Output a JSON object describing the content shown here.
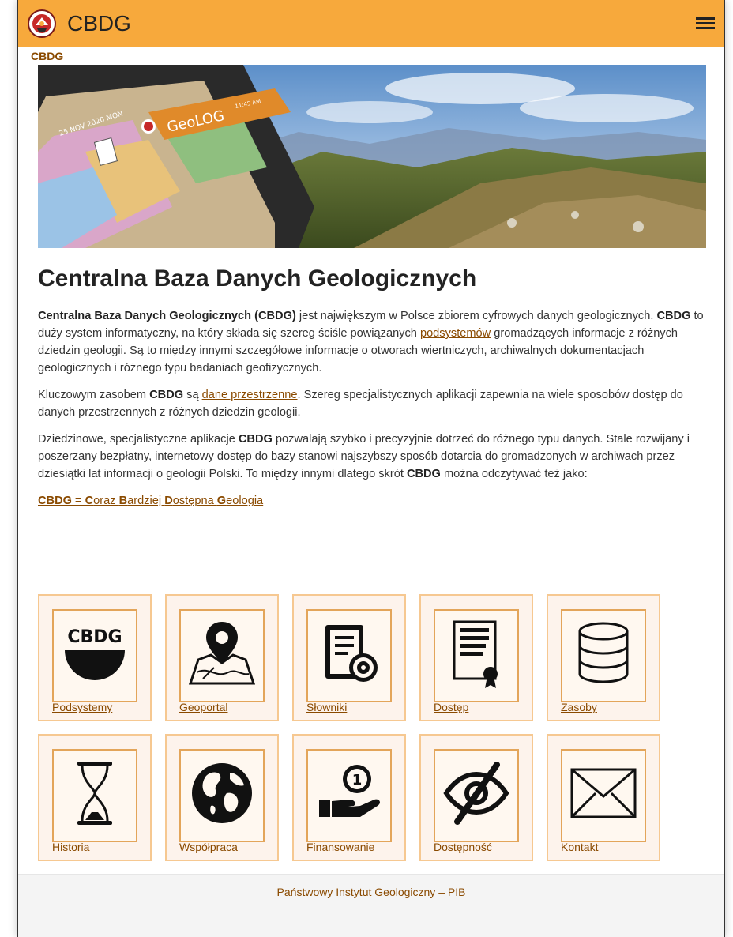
{
  "header": {
    "app_title": "CBDG",
    "logo_icon": "pgi-logo-icon",
    "menu_icon": "hamburger-menu-icon",
    "accent_color": "#f7a93c"
  },
  "breadcrumb": "CBDG",
  "hero": {
    "device_date": "25 NOV 2020 MON",
    "app_name": "GeoLOG",
    "time": "11:45 AM"
  },
  "main": {
    "title": "Centralna Baza Danych Geologicznych",
    "p1": {
      "bold1": "Centralna Baza Danych Geologicznych (CBDG)",
      "t1": " jest największym w Polsce zbiorem cyfrowych danych geologicznych. ",
      "bold2": "CBDG",
      "t2": " to duży system informatyczny, na który składa się szereg ściśle powiązanych ",
      "link": "podsystemów",
      "t3": " gromadzących informacje z różnych dziedzin geologii. Są to między innymi szczegółowe informacje o otworach wiertniczych, archiwalnych dokumentacjach geologicznych i różnego typu badaniach geofizycznych."
    },
    "p2": {
      "t1": "Kluczowym zasobem ",
      "bold1": "CBDG",
      "t2": " są ",
      "link": "dane przestrzenne",
      "t3": ". Szereg specjalistycznych aplikacji zapewnia na wiele sposobów dostęp do danych przestrzennych z różnych dziedzin geologii."
    },
    "p3": {
      "t1": "Dziedzinowe, specjalistyczne aplikacje ",
      "bold1": "CBDG",
      "t2": " pozwalają szybko i precyzyjnie dotrzeć do różnego typu danych. Stale rozwijany i poszerzany bezpłatny, internetowy dostęp do bazy stanowi najszybszy sposób dotarcia do gromadzonych w archiwach przez dziesiątki lat informacji o geologii Polski. To między innymi dlatego skrót ",
      "bold2": "CBDG",
      "t3": " można odczytywać też jako:"
    },
    "acronym": {
      "prefix": "CBDG = ",
      "w1b": "C",
      "w1": "oraz ",
      "w2b": "B",
      "w2": "ardziej ",
      "w3b": "D",
      "w3": "ostępna ",
      "w4b": "G",
      "w4": "eologia"
    }
  },
  "tiles": [
    {
      "label": "Podsystemy",
      "icon": "cbdg-bowl-icon"
    },
    {
      "label": "Geoportal",
      "icon": "map-pin-icon"
    },
    {
      "label": "Słowniki",
      "icon": "book-gear-icon"
    },
    {
      "label": "Dostęp",
      "icon": "certificate-icon"
    },
    {
      "label": "Zasoby",
      "icon": "database-icon"
    },
    {
      "label": "Historia",
      "icon": "hourglass-icon"
    },
    {
      "label": "Współpraca",
      "icon": "globe-icon"
    },
    {
      "label": "Finansowanie",
      "icon": "hand-coin-icon"
    },
    {
      "label": "Dostępność",
      "icon": "eye-slash-icon"
    },
    {
      "label": "Kontakt",
      "icon": "envelope-icon"
    }
  ],
  "tile_icon_text": "CBDG",
  "coin_number": "1",
  "footer": {
    "link": "Państwowy Instytut Geologiczny – PIB"
  }
}
